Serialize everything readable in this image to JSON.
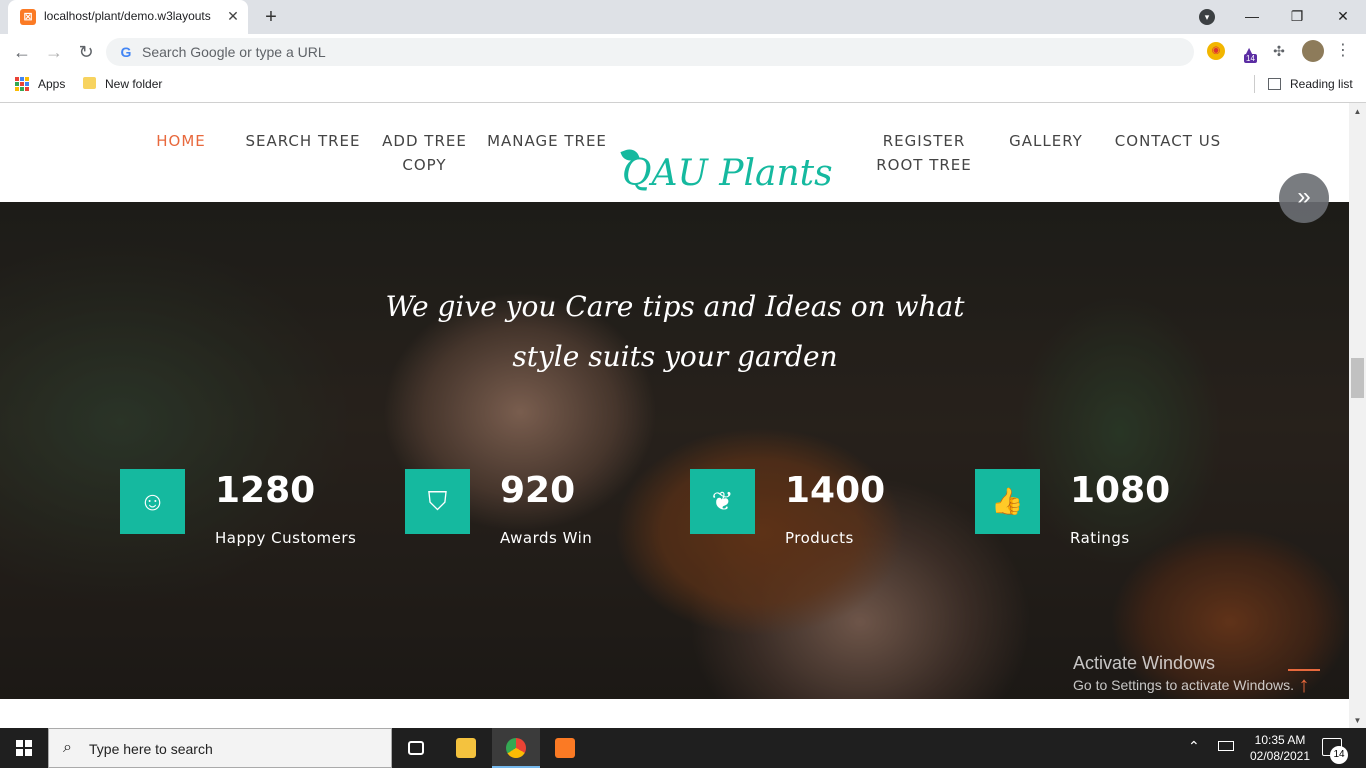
{
  "browser": {
    "tab_title": "localhost/plant/demo.w3layouts",
    "tab_close": "✕",
    "new_tab": "+",
    "omnibox_placeholder": "Search Google or type a URL",
    "extension_badge": "14",
    "bookmarks": [
      {
        "label": "Apps",
        "icon": "apps-grid-icon"
      },
      {
        "label": "New folder",
        "icon": "folder-icon"
      }
    ],
    "reading_list": "Reading list"
  },
  "site": {
    "nav": [
      {
        "label": "HOME",
        "active": true
      },
      {
        "label": "SEARCH TREE"
      },
      {
        "label": "ADD TREE COPY"
      },
      {
        "label": "MANAGE TREE"
      },
      {
        "label": "REGISTER ROOT TREE"
      },
      {
        "label": "GALLERY"
      },
      {
        "label": "CONTACT US"
      }
    ],
    "logo": "QAU Plants",
    "slider_next": "»",
    "hero_title_line1": "We give you Care tips and Ideas on what",
    "hero_title_line2": "style suits your garden",
    "stats": [
      {
        "value": "1280",
        "label": "Happy Customers",
        "icon": "smile-icon"
      },
      {
        "value": "920",
        "label": "Awards Win",
        "icon": "shield-icon"
      },
      {
        "value": "1400",
        "label": "Products",
        "icon": "leaf-icon"
      },
      {
        "value": "1080",
        "label": "Ratings",
        "icon": "thumbs-up-icon"
      }
    ],
    "back_to_top": "↑"
  },
  "watermark": {
    "line1": "Activate Windows",
    "line2": "Go to Settings to activate Windows."
  },
  "taskbar": {
    "search_placeholder": "Type here to search",
    "time": "10:35 AM",
    "date": "02/08/2021",
    "notification_count": "14"
  },
  "colors": {
    "accent": "#15b99f",
    "nav_active": "#e8693d"
  }
}
